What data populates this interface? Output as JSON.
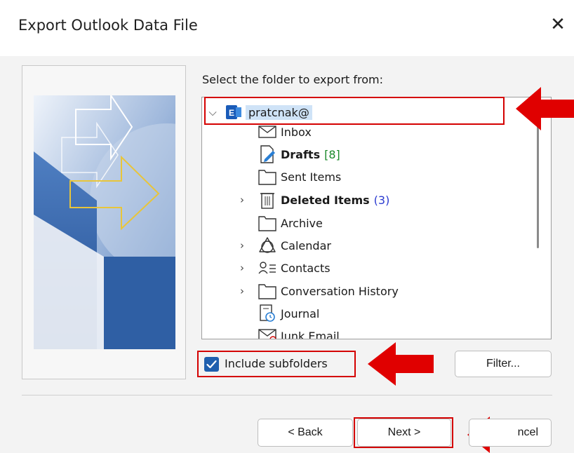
{
  "dialog": {
    "title": "Export Outlook Data File",
    "close_icon": "close-icon"
  },
  "prompt": "Select the folder to export from:",
  "tree": {
    "account": "pratcnak@",
    "items": [
      {
        "label": "Inbox",
        "icon": "envelope-icon",
        "bold": false,
        "count": "",
        "expandable": false
      },
      {
        "label": "Drafts",
        "icon": "draft-icon",
        "bold": true,
        "count": "[8]",
        "expandable": false
      },
      {
        "label": "Sent Items",
        "icon": "folder-icon",
        "bold": false,
        "count": "",
        "expandable": false
      },
      {
        "label": "Deleted Items",
        "icon": "trash-icon",
        "bold": true,
        "count": "(3)",
        "expandable": true
      },
      {
        "label": "Archive",
        "icon": "folder-icon",
        "bold": false,
        "count": "",
        "expandable": false
      },
      {
        "label": "Calendar",
        "icon": "calendar-icon",
        "bold": false,
        "count": "",
        "expandable": true
      },
      {
        "label": "Contacts",
        "icon": "contacts-icon",
        "bold": false,
        "count": "",
        "expandable": true
      },
      {
        "label": "Conversation History",
        "icon": "folder-icon",
        "bold": false,
        "count": "",
        "expandable": true
      },
      {
        "label": "Journal",
        "icon": "journal-icon",
        "bold": false,
        "count": "",
        "expandable": false
      },
      {
        "label": "Junk Email",
        "icon": "junk-icon",
        "bold": false,
        "count": "",
        "expandable": false
      }
    ]
  },
  "options": {
    "include_subfolders_label": "Include subfolders",
    "include_subfolders_checked": true,
    "filter_label": "Filter..."
  },
  "buttons": {
    "back": "< Back",
    "next": "Next >",
    "cancel_visible": "ncel"
  },
  "colors": {
    "highlight_red": "#d40000",
    "selection_blue": "#cfe3f7",
    "checkbox_blue": "#1f5fae"
  }
}
